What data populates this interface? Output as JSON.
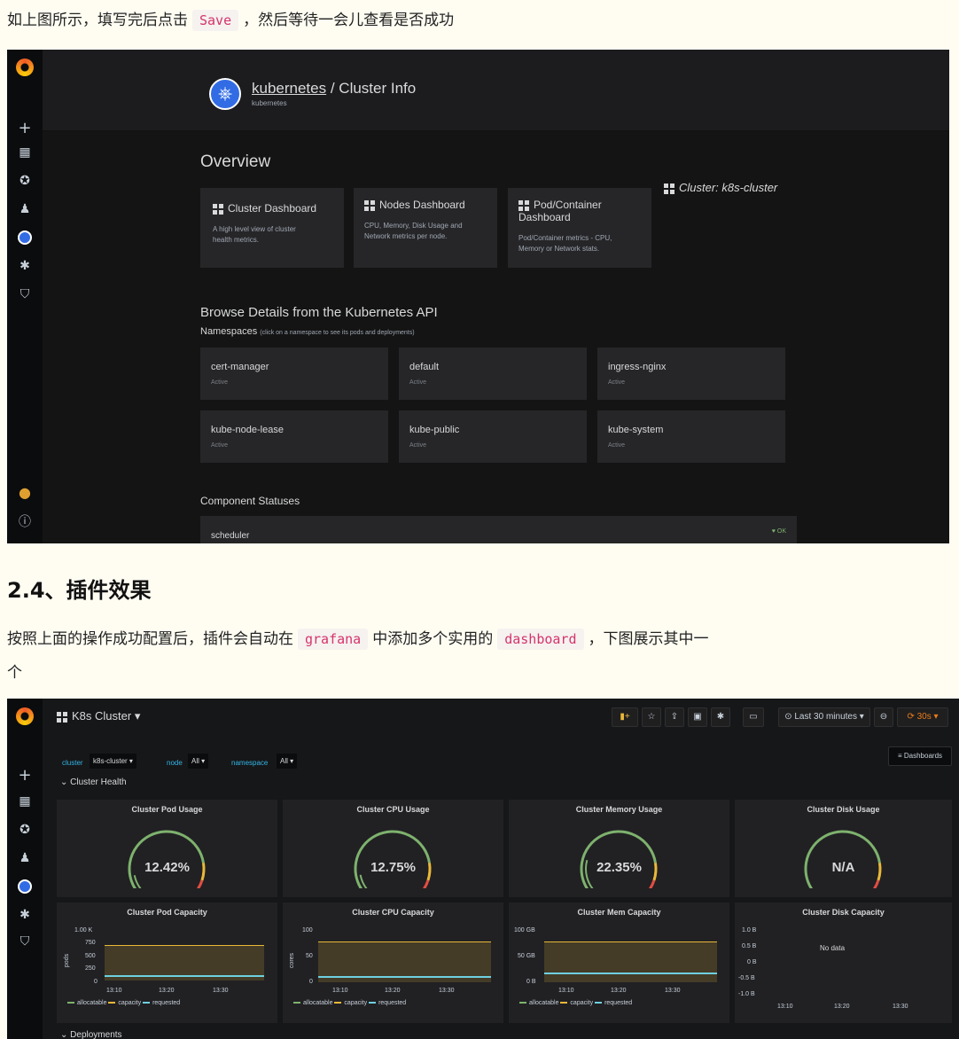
{
  "doc": {
    "line1_a": "如上图所示，填写完后点击",
    "line1_code": "Save",
    "line1_b": "，然后等待一会儿查看是否成功",
    "heading": "2.4、插件效果",
    "para_a": "按照上面的操作成功配置后，插件会自动在",
    "para_code1": "grafana",
    "para_b": "中添加多个实用的",
    "para_code2": "dashboard",
    "para_c": "，下图展示其中一",
    "para_d": "个"
  },
  "s1": {
    "title_link": "kubernetes",
    "title_rest": " / Cluster Info",
    "title_sub": "kubernetes",
    "overview": "Overview",
    "cluster_label": "Cluster: k8s-cluster",
    "cards": [
      {
        "title": "Cluster Dashboard",
        "desc1": "A high level view of cluster",
        "desc2": "health metrics."
      },
      {
        "title": "Nodes Dashboard",
        "desc1": "CPU, Memory, Disk Usage and",
        "desc2": "Network metrics per node."
      },
      {
        "title": "Pod/Container",
        "title2": "Dashboard",
        "desc1": "Pod/Container metrics - CPU,",
        "desc2": "Memory or Network stats."
      }
    ],
    "browse": "Browse Details from the Kubernetes API",
    "ns_label": "Namespaces",
    "ns_hint": "(click on a namespace to see its pods and deployments)",
    "namespaces": [
      {
        "name": "cert-manager",
        "status": "Active"
      },
      {
        "name": "default",
        "status": "Active"
      },
      {
        "name": "ingress-nginx",
        "status": "Active"
      },
      {
        "name": "kube-node-lease",
        "status": "Active"
      },
      {
        "name": "kube-public",
        "status": "Active"
      },
      {
        "name": "kube-system",
        "status": "Active"
      }
    ],
    "components": "Component Statuses",
    "scheduler": "scheduler",
    "ok": "♥ OK"
  },
  "s2": {
    "title": "K8s Cluster",
    "time": "Last 30 minutes",
    "refresh": "30s",
    "vars": {
      "cluster_label": "cluster",
      "cluster_val": "k8s-cluster",
      "node_label": "node",
      "node_val": "All",
      "ns_label": "namespace",
      "ns_val": "All"
    },
    "dashboards_btn": "≡ Dashboards",
    "row_title": "Cluster Health",
    "bottom_row": "Deployments",
    "gauges": [
      {
        "title": "Cluster Pod Usage",
        "value": "12.42%",
        "pct": 0.1242
      },
      {
        "title": "Cluster CPU Usage",
        "value": "12.75%",
        "pct": 0.1275
      },
      {
        "title": "Cluster Memory Usage",
        "value": "22.35%",
        "pct": 0.2235
      },
      {
        "title": "Cluster Disk Usage",
        "value": "N/A",
        "pct": 0
      }
    ],
    "graphs": [
      {
        "title": "Cluster Pod Capacity",
        "ylabel": "pods",
        "yticks": [
          "1.00 K",
          "750",
          "500",
          "250",
          "0"
        ],
        "xticks": [
          "13:10",
          "13:20",
          "13:30"
        ]
      },
      {
        "title": "Cluster CPU Capacity",
        "ylabel": "cores",
        "yticks": [
          "100",
          "50",
          "0"
        ],
        "xticks": [
          "13:10",
          "13:20",
          "13:30"
        ]
      },
      {
        "title": "Cluster Mem Capacity",
        "ylabel": "",
        "yticks": [
          "100 GB",
          "50 GB",
          "0 B"
        ],
        "xticks": [
          "13:10",
          "13:20",
          "13:30"
        ]
      },
      {
        "title": "Cluster Disk Capacity",
        "ylabel": "",
        "yticks": [
          "1.0 B",
          "0.5 B",
          "0 B",
          "-0.5 B",
          "-1.0 B"
        ],
        "xticks": [
          "13:10",
          "13:20",
          "13:30"
        ],
        "nodata": "No data"
      }
    ],
    "legend": {
      "allocatable": "allocatable",
      "capacity": "capacity",
      "requested": "requested"
    },
    "colors": {
      "allocatable": "#7eb26d",
      "capacity": "#eab839",
      "requested": "#6ed0e0"
    }
  }
}
